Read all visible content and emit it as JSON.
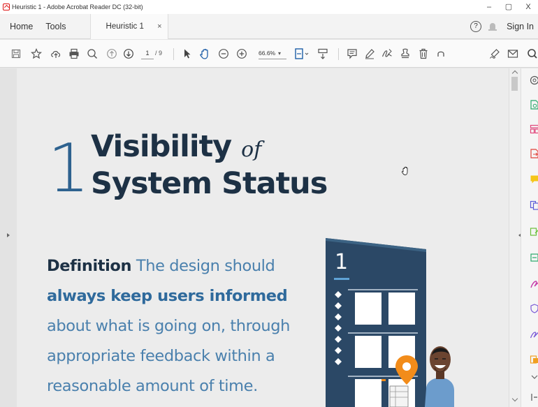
{
  "window": {
    "title": "Heuristic 1 - Adobe Acrobat Reader DC (32-bit)",
    "controls": [
      "–",
      "▢",
      "X"
    ]
  },
  "tabs": {
    "home": "Home",
    "tools": "Tools",
    "document_tab": "Heuristic 1",
    "close": "×",
    "help": "?",
    "sign_in": "Sign In"
  },
  "toolbar": {
    "current_page": "1",
    "total_pages": "/ 9",
    "zoom": "66.6%",
    "zoom_dropdown": "▾"
  },
  "document": {
    "number": "1",
    "heading_word1": "Visibility",
    "heading_of": "of",
    "heading_line2": "System Status",
    "definition_label": "Definition",
    "definition_text_1": " The design should ",
    "definition_bold": "always keep users informed",
    "definition_text_2": " about what is going on, through appropriate feedback within a reasonable amount of time.",
    "illustration_number": "1"
  },
  "colors": {
    "heading": "#1d3145",
    "accent_blue": "#2e628f",
    "text_blue": "#4a80ad",
    "illustration_panel": "#2b4866",
    "pin_orange": "#f28c1a"
  }
}
